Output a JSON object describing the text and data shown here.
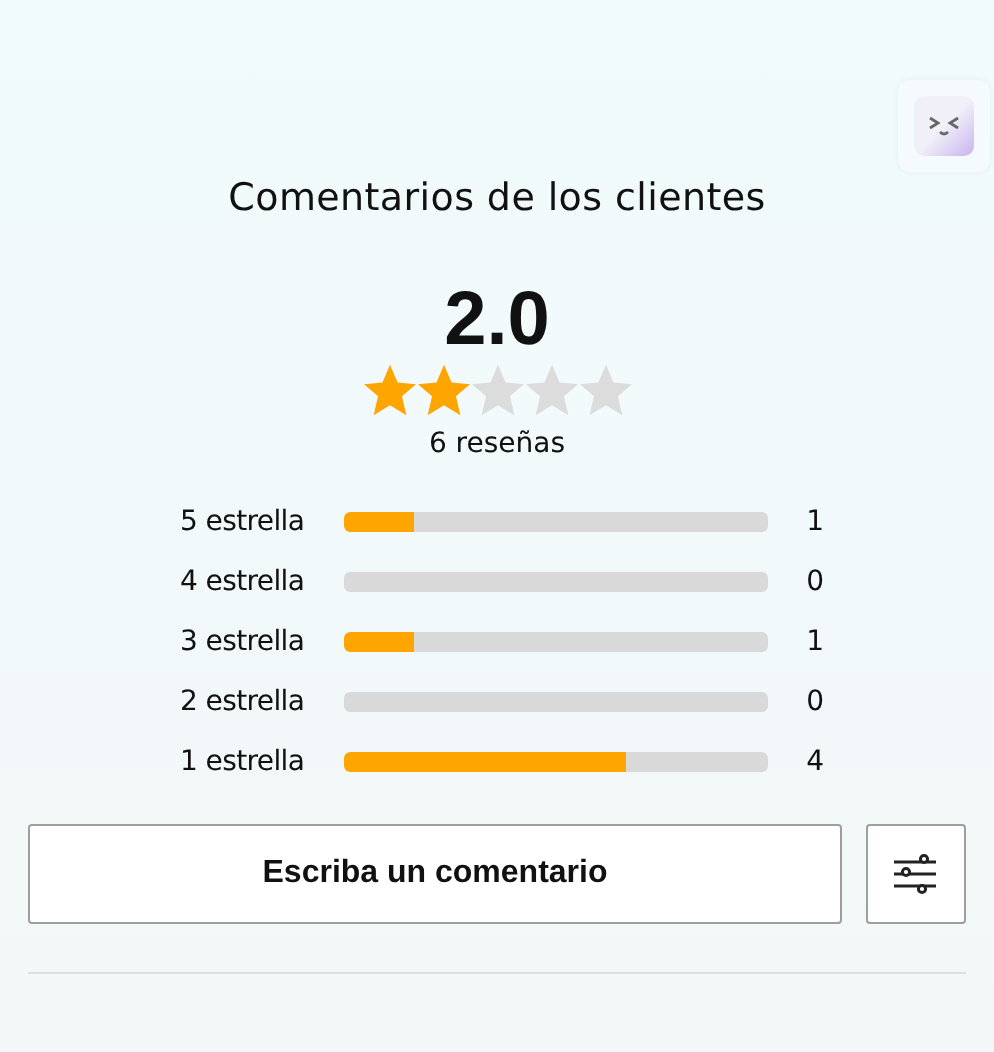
{
  "title": "Comentarios de los clientes",
  "rating": "2.0",
  "stars": 2,
  "review_count": "6 reseñas",
  "distribution": [
    {
      "label": "5 estrella",
      "level": 0.167,
      "count": "1"
    },
    {
      "label": "4 estrella",
      "level": 0,
      "count": "0"
    },
    {
      "label": "3 estrella",
      "level": 0.167,
      "count": "1"
    },
    {
      "label": "2 estrella",
      "level": 0,
      "count": "0"
    },
    {
      "label": "1 estrella",
      "level": 0.667,
      "count": "4"
    }
  ],
  "write_button": "Escriba un comentario"
}
